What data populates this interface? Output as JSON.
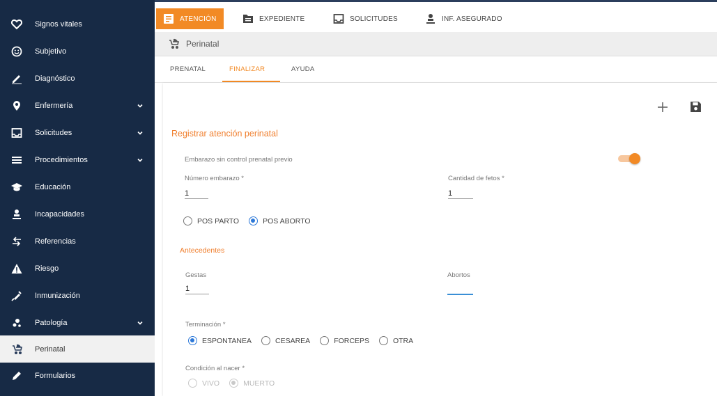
{
  "sidebar": {
    "items": [
      {
        "label": "Signos vitales",
        "icon": "heart-icon",
        "has_chevron": false,
        "active": false
      },
      {
        "label": "Subjetivo",
        "icon": "smiley-icon",
        "has_chevron": false,
        "active": false
      },
      {
        "label": "Diagnóstico",
        "icon": "pencil-icon",
        "has_chevron": false,
        "active": false
      },
      {
        "label": "Enfermería",
        "icon": "map-pin-icon",
        "has_chevron": true,
        "active": false
      },
      {
        "label": "Solicitudes",
        "icon": "inbox-icon",
        "has_chevron": true,
        "active": false
      },
      {
        "label": "Procedimientos",
        "icon": "list-icon",
        "has_chevron": true,
        "active": false
      },
      {
        "label": "Educación",
        "icon": "graduation-cap-icon",
        "has_chevron": false,
        "active": false
      },
      {
        "label": "Incapacidades",
        "icon": "person-icon",
        "has_chevron": false,
        "active": false
      },
      {
        "label": "Referencias",
        "icon": "transfer-arrows-icon",
        "has_chevron": false,
        "active": false
      },
      {
        "label": "Riesgo",
        "icon": "warning-triangle-icon",
        "has_chevron": false,
        "active": false
      },
      {
        "label": "Inmunización",
        "icon": "syringe-icon",
        "has_chevron": false,
        "active": false
      },
      {
        "label": "Patología",
        "icon": "virus-icon",
        "has_chevron": true,
        "active": false
      },
      {
        "label": "Perinatal",
        "icon": "stroller-icon",
        "has_chevron": false,
        "active": true
      },
      {
        "label": "Formularios",
        "icon": "pen-icon",
        "has_chevron": false,
        "active": false
      }
    ]
  },
  "topbar": {
    "tabs": [
      {
        "label": "ATENCIÓN",
        "icon": "clipboard-icon",
        "active": true
      },
      {
        "label": "EXPEDIENTE",
        "icon": "folder-icon",
        "active": false
      },
      {
        "label": "SOLICITUDES",
        "icon": "inbox-icon",
        "active": false
      },
      {
        "label": "INF. ASEGURADO",
        "icon": "person-icon",
        "active": false
      }
    ]
  },
  "section": {
    "title": "Perinatal",
    "icon": "stroller-icon"
  },
  "subtabs": [
    {
      "label": "PRENATAL",
      "active": false
    },
    {
      "label": "FINALIZAR",
      "active": true
    },
    {
      "label": "AYUDA",
      "active": false
    }
  ],
  "actions": {
    "add_icon": "plus-icon",
    "save_icon": "floppy-disk-icon"
  },
  "form": {
    "heading": "Registrar atención perinatal",
    "toggle_label": "Embarazo sin control prenatal previo",
    "toggle_on": true,
    "numero_embarazo": {
      "label": "Número embarazo *",
      "value": "1"
    },
    "cantidad_fetos": {
      "label": "Cantidad de fetos *",
      "value": "1"
    },
    "tipo": {
      "options": [
        "POS PARTO",
        "POS ABORTO"
      ],
      "selected": "POS ABORTO"
    },
    "antecedentes_heading": "Antecedentes",
    "gestas": {
      "label": "Gestas",
      "value": "1"
    },
    "abortos": {
      "label": "Abortos",
      "value": ""
    },
    "terminacion": {
      "label": "Terminación *",
      "options": [
        "ESPONTANEA",
        "CESAREA",
        "FORCEPS",
        "OTRA"
      ],
      "selected": "ESPONTANEA"
    },
    "condicion": {
      "label": "Condición al nacer *",
      "options": [
        "VIVO",
        "MUERTO"
      ],
      "selected": "MUERTO",
      "disabled": true
    }
  },
  "colors": {
    "sidebar_bg": "#172a45",
    "accent": "#f28a25",
    "radio_selected": "#2c78d8",
    "input_focus": "#3a8fd6"
  }
}
